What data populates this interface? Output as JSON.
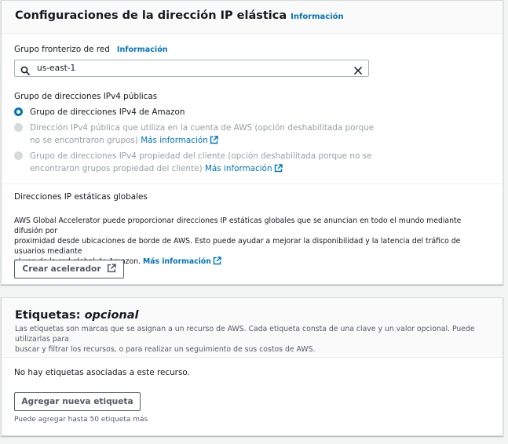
{
  "eip_settings": {
    "title": "Configuraciones de la dirección IP elástica",
    "info_link": "Información",
    "border_group": {
      "label": "Grupo fronterizo de red",
      "info_link": "Información",
      "value": "us-east-1"
    },
    "pool": {
      "label": "Grupo de direcciones IPv4 públicas",
      "options": [
        {
          "text": "Grupo de direcciones IPv4 de Amazon",
          "selected": true,
          "disabled": false
        },
        {
          "line1": "Dirección IPv4 pública que utiliza en la cuenta de AWS (opción deshabilitada porque",
          "line2": "no se encontraron grupos)",
          "more": "Más información",
          "disabled": true
        },
        {
          "line1": "Grupo de direcciones IPv4 propiedad del cliente (opción deshabilitada porque no se",
          "line2": "encontraron grupos propiedad del cliente)",
          "more": "Más información",
          "disabled": true
        }
      ]
    },
    "global": {
      "label": "Direcciones IP estáticas globales",
      "line1": "AWS Global Accelerator puede proporcionar direcciones IP estáticas globales que se anuncian en todo el mundo mediante difusión por",
      "line2": "proximidad desde ubicaciones de borde de AWS. Esto puede ayudar a mejorar la disponibilidad y la latencia del tráfico de usuarios mediante",
      "line3": "el uso de la red global de Amazon.",
      "more": "Más información",
      "button": "Crear acelerador"
    }
  },
  "tags": {
    "title_main": "Etiquetas:",
    "title_optional": "opcional",
    "desc_line1": "Las etiquetas son marcas que se asignan a un recurso de AWS. Cada etiqueta consta de una clave y un valor opcional. Puede utilizarlas para",
    "desc_line2": "buscar y filtrar los recursos, o para realizar un seguimiento de sus costos de AWS.",
    "empty": "No hay etiquetas asociadas a este recurso.",
    "add_button": "Agregar nueva etiqueta",
    "limit_hint": "Puede agregar hasta 50 etiqueta más"
  },
  "colors": {
    "link": "#0073bb",
    "text": "#16191f",
    "muted": "#545b64",
    "disabled": "#95a0a5"
  }
}
